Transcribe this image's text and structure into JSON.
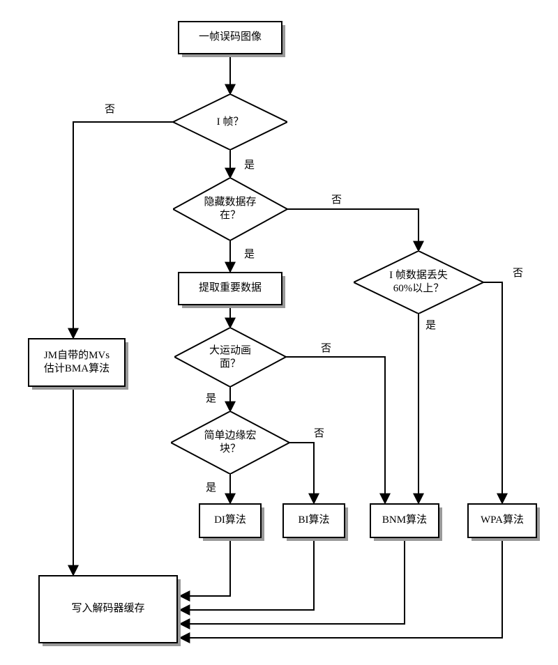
{
  "nodes": {
    "start": "一帧误码图像",
    "d_iframe": "I 帧？",
    "d_hidden": "隐藏数据存\n在？",
    "extract": "提取重要数据",
    "d_bigmotion": "大运动画\n面？",
    "d_simpleedge": "简单边缘宏\n块？",
    "d_60pct": "I 帧数据丢失\n60%以上？",
    "jm": "JM自带的MVs\n估计BMA算法",
    "di": "DI算法",
    "bi": "BI算法",
    "bnm": "BNM算法",
    "wpa": "WPA算法",
    "write": "写入解码器缓存"
  },
  "branch": {
    "yes": "是",
    "no": "否"
  },
  "chart_data": {
    "type": "flowchart",
    "title": "",
    "nodes": [
      {
        "id": "start",
        "kind": "process",
        "label": "一帧误码图像"
      },
      {
        "id": "d_iframe",
        "kind": "decision",
        "label": "I 帧？"
      },
      {
        "id": "d_hidden",
        "kind": "decision",
        "label": "隐藏数据存在？"
      },
      {
        "id": "extract",
        "kind": "process",
        "label": "提取重要数据"
      },
      {
        "id": "d_bigmotion",
        "kind": "decision",
        "label": "大运动画面？"
      },
      {
        "id": "d_simpleedge",
        "kind": "decision",
        "label": "简单边缘宏块？"
      },
      {
        "id": "d_60pct",
        "kind": "decision",
        "label": "I 帧数据丢失 60% 以上？"
      },
      {
        "id": "jm",
        "kind": "process",
        "label": "JM自带的MVs估计BMA算法"
      },
      {
        "id": "di",
        "kind": "process",
        "label": "DI算法"
      },
      {
        "id": "bi",
        "kind": "process",
        "label": "BI算法"
      },
      {
        "id": "bnm",
        "kind": "process",
        "label": "BNM算法"
      },
      {
        "id": "wpa",
        "kind": "process",
        "label": "WPA算法"
      },
      {
        "id": "write",
        "kind": "terminal",
        "label": "写入解码器缓存"
      }
    ],
    "edges": [
      {
        "from": "start",
        "to": "d_iframe"
      },
      {
        "from": "d_iframe",
        "to": "d_hidden",
        "label": "是"
      },
      {
        "from": "d_iframe",
        "to": "jm",
        "label": "否"
      },
      {
        "from": "d_hidden",
        "to": "extract",
        "label": "是"
      },
      {
        "from": "d_hidden",
        "to": "d_60pct",
        "label": "否"
      },
      {
        "from": "extract",
        "to": "d_bigmotion"
      },
      {
        "from": "d_bigmotion",
        "to": "d_simpleedge",
        "label": "是"
      },
      {
        "from": "d_bigmotion",
        "to": "bnm",
        "label": "否"
      },
      {
        "from": "d_simpleedge",
        "to": "di",
        "label": "是"
      },
      {
        "from": "d_simpleedge",
        "to": "bi",
        "label": "否"
      },
      {
        "from": "d_60pct",
        "to": "bnm",
        "label": "是"
      },
      {
        "from": "d_60pct",
        "to": "wpa",
        "label": "否"
      },
      {
        "from": "jm",
        "to": "write"
      },
      {
        "from": "di",
        "to": "write"
      },
      {
        "from": "bi",
        "to": "write"
      },
      {
        "from": "bnm",
        "to": "write"
      },
      {
        "from": "wpa",
        "to": "write"
      }
    ]
  }
}
